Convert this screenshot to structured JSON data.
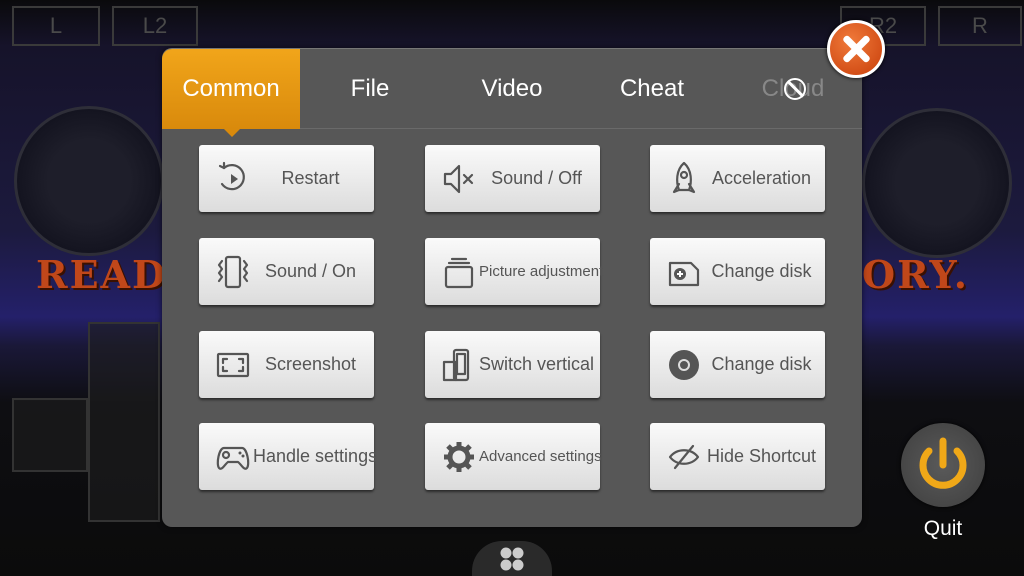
{
  "background": {
    "shoulders": [
      "L",
      "L2",
      "R2",
      "R"
    ],
    "game_text_left": "READ",
    "game_text_right": "ORY."
  },
  "tabs": [
    {
      "label": "Common",
      "active": true
    },
    {
      "label": "File"
    },
    {
      "label": "Video"
    },
    {
      "label": "Cheat"
    },
    {
      "label": "Cloud",
      "disabled": true,
      "icon": "ban-icon"
    }
  ],
  "buttons": [
    {
      "label": "Restart",
      "icon": "restart-icon"
    },
    {
      "label": "Sound / Off",
      "icon": "speaker-mute-icon"
    },
    {
      "label": "Acceleration",
      "icon": "rocket-icon"
    },
    {
      "label": "Sound / On",
      "icon": "phone-vibrate-icon"
    },
    {
      "label": "Picture adjustment",
      "icon": "picture-stack-icon"
    },
    {
      "label": "Change disk",
      "icon": "add-file-icon"
    },
    {
      "label": "Screenshot",
      "icon": "screenshot-frame-icon"
    },
    {
      "label": "Switch vertical",
      "icon": "rotate-phone-icon"
    },
    {
      "label": "Change disk",
      "icon": "disc-icon"
    },
    {
      "label": "Handle settings",
      "icon": "gamepad-icon"
    },
    {
      "label": "Advanced settings",
      "icon": "gear-icon"
    },
    {
      "label": "Hide Shortcut",
      "icon": "eye-off-icon"
    }
  ],
  "quit": {
    "label": "Quit",
    "icon": "power-icon"
  },
  "colors": {
    "accent": "#f1a51a",
    "close": "#e0581e",
    "panel": "#575757"
  }
}
